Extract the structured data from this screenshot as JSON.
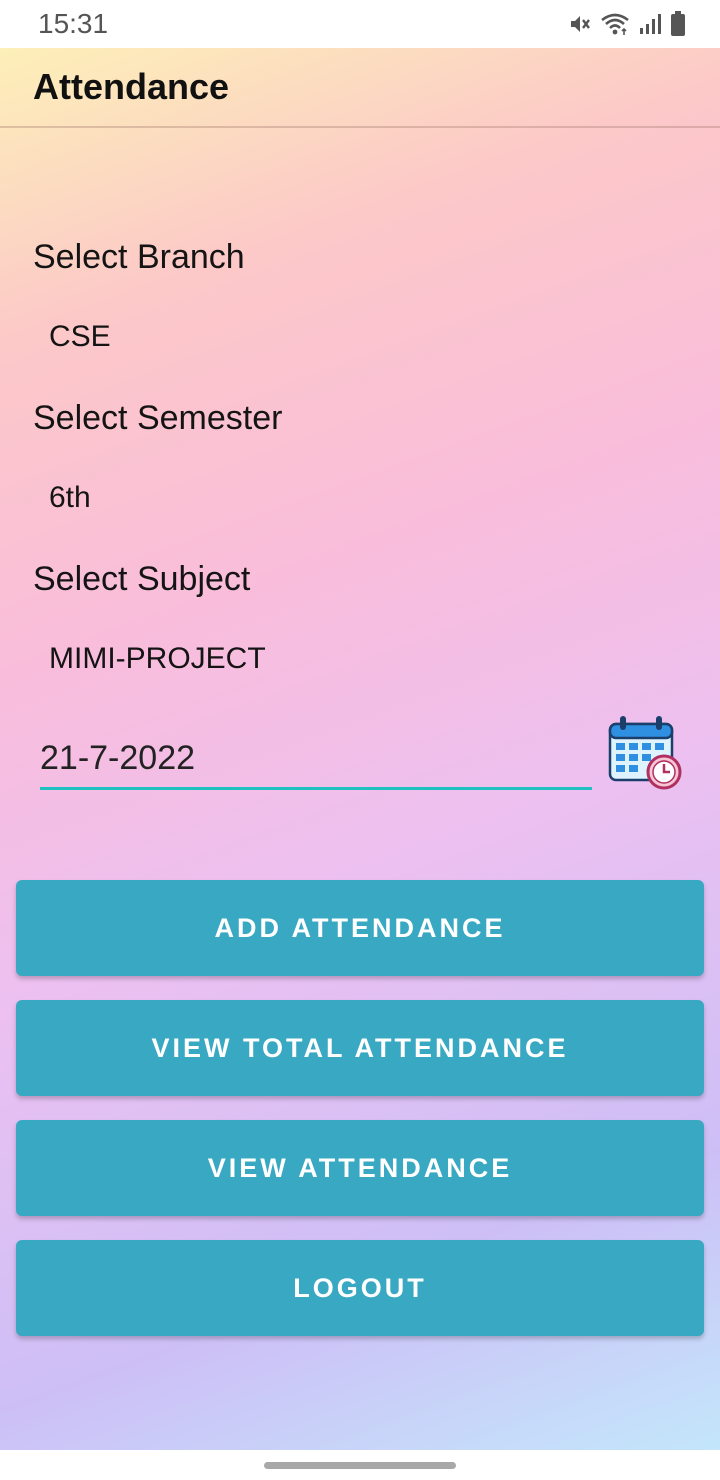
{
  "status_bar": {
    "time": "15:31",
    "icons": [
      "mute-icon",
      "wifi-icon",
      "signal-icon",
      "battery-icon"
    ]
  },
  "app_bar": {
    "title": "Attendance"
  },
  "form": {
    "branch_label": "Select Branch",
    "branch_value": "CSE",
    "semester_label": "Select Semester",
    "semester_value": "6th",
    "subject_label": "Select Subject",
    "subject_value": "MIMI-PROJECT",
    "date_value": "21-7-2022",
    "calendar_icon": "calendar-icon"
  },
  "actions": {
    "add_attendance": "ADD ATTENDANCE",
    "view_total_attendance": "VIEW TOTAL ATTENDANCE",
    "view_attendance": "VIEW ATTENDANCE",
    "logout": "LOGOUT"
  },
  "colors": {
    "button": "#39a8c2",
    "input_underline": "#1fc0c0"
  }
}
